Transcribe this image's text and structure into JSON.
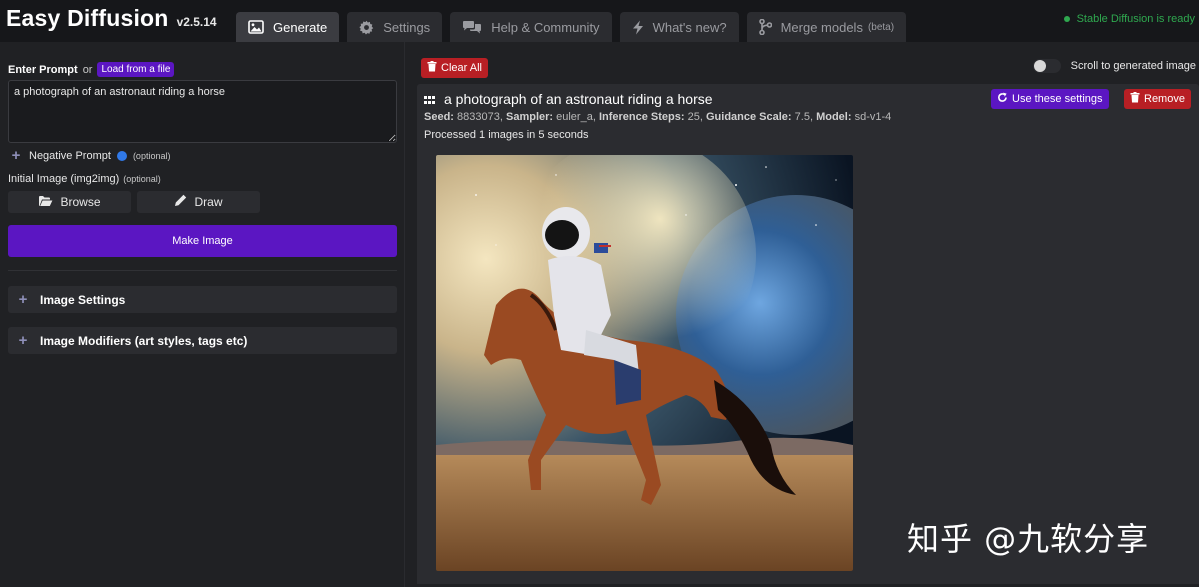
{
  "app": {
    "title": "Easy Diffusion",
    "version": "v2.5.14"
  },
  "tabs": [
    {
      "label": "Generate",
      "icon": "image-icon"
    },
    {
      "label": "Settings",
      "icon": "gear-icon"
    },
    {
      "label": "Help & Community",
      "icon": "comments-icon"
    },
    {
      "label": "What's new?",
      "icon": "bolt-icon"
    },
    {
      "label": "Merge models",
      "suffix": "(beta)",
      "icon": "merge-icon"
    }
  ],
  "status": {
    "text": "Stable Diffusion is ready",
    "color": "#2fa84f"
  },
  "prompt": {
    "label": "Enter Prompt",
    "or_text": "or",
    "load_label": "Load from a file",
    "value": "a photograph of an astronaut riding a horse"
  },
  "negative": {
    "label": "Negative Prompt",
    "optional": "(optional)"
  },
  "init_image": {
    "label": "Initial Image (img2img)",
    "optional": "(optional)",
    "browse_label": "Browse",
    "draw_label": "Draw"
  },
  "make_image_label": "Make Image",
  "sections": {
    "image_settings": "Image Settings",
    "image_modifiers": "Image Modifiers (art styles, tags etc)"
  },
  "toolbar": {
    "clear_all": "Clear All",
    "scroll_label": "Scroll to generated image"
  },
  "result": {
    "title": "a photograph of an astronaut riding a horse",
    "use_settings": "Use these settings",
    "remove": "Remove",
    "seed_label": "Seed:",
    "seed": "8833073",
    "sampler_label": "Sampler:",
    "sampler": "euler_a",
    "steps_label": "Inference Steps:",
    "steps": "25",
    "guidance_label": "Guidance Scale:",
    "guidance": "7.5",
    "model_label": "Model:",
    "model": "sd-v1-4",
    "processed": "Processed 1 images in 5 seconds"
  },
  "watermark": "知乎 @九软分享",
  "colors": {
    "accent": "#5b16c2",
    "danger": "#b81f24",
    "background": "#202124",
    "panel": "#2b2c30"
  }
}
